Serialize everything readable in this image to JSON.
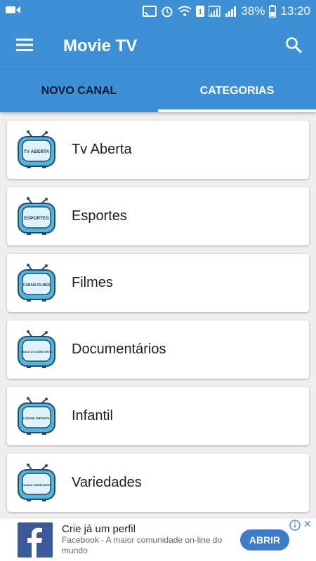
{
  "status_bar": {
    "battery": "38%",
    "time": "13:20",
    "bg_color": "#3d8fd6"
  },
  "app_bar": {
    "title": "Movie TV",
    "menu_icon": "hamburger-menu-icon",
    "search_icon": "search-icon"
  },
  "tabs": [
    {
      "label": "NOVO CANAL",
      "active": false
    },
    {
      "label": "CATEGORIAS",
      "active": true
    }
  ],
  "categories": [
    {
      "label": "Tv Aberta",
      "icon_text": "TV ABERTA",
      "icon": "tv-icon"
    },
    {
      "label": "Esportes",
      "icon_text": "ESPORTES",
      "icon": "tv-icon"
    },
    {
      "label": "Filmes",
      "icon_text": "CANAIS FILMES",
      "icon": "tv-icon"
    },
    {
      "label": "Documentários",
      "icon_text": "CANAIS DOCUMENTÁRIOS",
      "icon": "tv-icon"
    },
    {
      "label": "Infantil",
      "icon_text": "CANAIS INFANTIL",
      "icon": "tv-icon"
    },
    {
      "label": "Variedades",
      "icon_text": "CANAIS VARIEDADES",
      "icon": "tv-icon"
    }
  ],
  "ad": {
    "title": "Crie já um perfil",
    "description": "Facebook - A maior comunidade on-line do mundo",
    "button": "ABRIR",
    "close": "✕",
    "logo_icon": "facebook-logo-icon"
  },
  "colors": {
    "primary": "#3d8fd6",
    "ad_button": "#3d7cc9",
    "facebook": "#3b5998"
  }
}
